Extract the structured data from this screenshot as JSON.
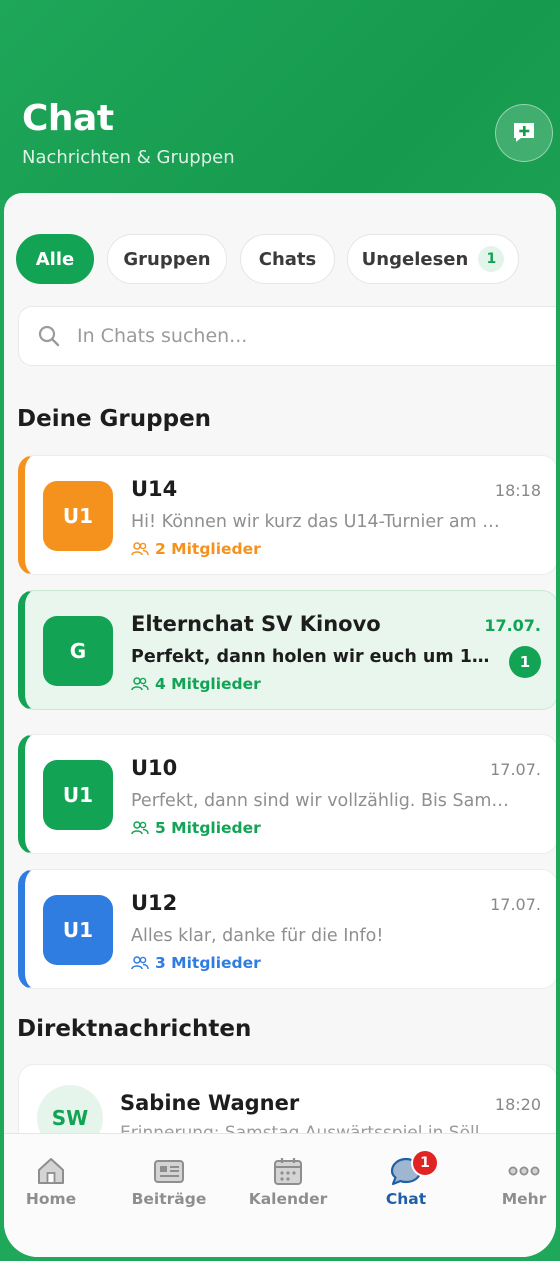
{
  "header": {
    "title": "Chat",
    "subtitle": "Nachrichten & Gruppen",
    "new_chat_icon": "message-plus-icon"
  },
  "tabs": [
    {
      "label": "Alle",
      "active": true
    },
    {
      "label": "Gruppen",
      "active": false
    },
    {
      "label": "Chats",
      "active": false
    },
    {
      "label": "Ungelesen",
      "active": false,
      "badge": "1"
    }
  ],
  "search": {
    "placeholder": "In Chats suchen..."
  },
  "groups_section": {
    "title": "Deine Gruppen"
  },
  "groups": [
    {
      "avatar": "U1",
      "name": "U14",
      "time": "18:18",
      "message": "Hi! Können wir kurz das U14-Turnier am W...",
      "members": "2 Mitglieder",
      "color": "#f5921e",
      "unread": false
    },
    {
      "avatar": "G",
      "name": "Elternchat SV Kinovo",
      "time": "17.07.",
      "message": "Perfekt, dann holen wir euch um 12:1...",
      "members": "4 Mitglieder",
      "color": "#12a355",
      "unread": true,
      "unread_count": "1"
    },
    {
      "avatar": "U1",
      "name": "U10",
      "time": "17.07.",
      "message": "Perfekt, dann sind wir vollzählig. Bis Samst...",
      "members": "5 Mitglieder",
      "color": "#12a355",
      "unread": false
    },
    {
      "avatar": "U1",
      "name": "U12",
      "time": "17.07.",
      "message": "Alles klar, danke für die Info!",
      "members": "3 Mitglieder",
      "color": "#2f7de1",
      "unread": false
    }
  ],
  "direct_section": {
    "title": "Direktnachrichten"
  },
  "direct_messages": [
    {
      "avatar": "SW",
      "name": "Sabine Wagner",
      "time": "18:20",
      "message": "Erinnerung: Samstag Auswärtsspiel in Söll"
    }
  ],
  "bottom_nav": [
    {
      "label": "Home",
      "icon": "home-icon",
      "active": false
    },
    {
      "label": "Beiträge",
      "icon": "newspaper-icon",
      "active": false
    },
    {
      "label": "Kalender",
      "icon": "calendar-icon",
      "active": false
    },
    {
      "label": "Chat",
      "icon": "chat-bubble-icon",
      "active": true,
      "badge": "1"
    },
    {
      "label": "Mehr",
      "icon": "more-dots-icon",
      "active": false
    }
  ]
}
